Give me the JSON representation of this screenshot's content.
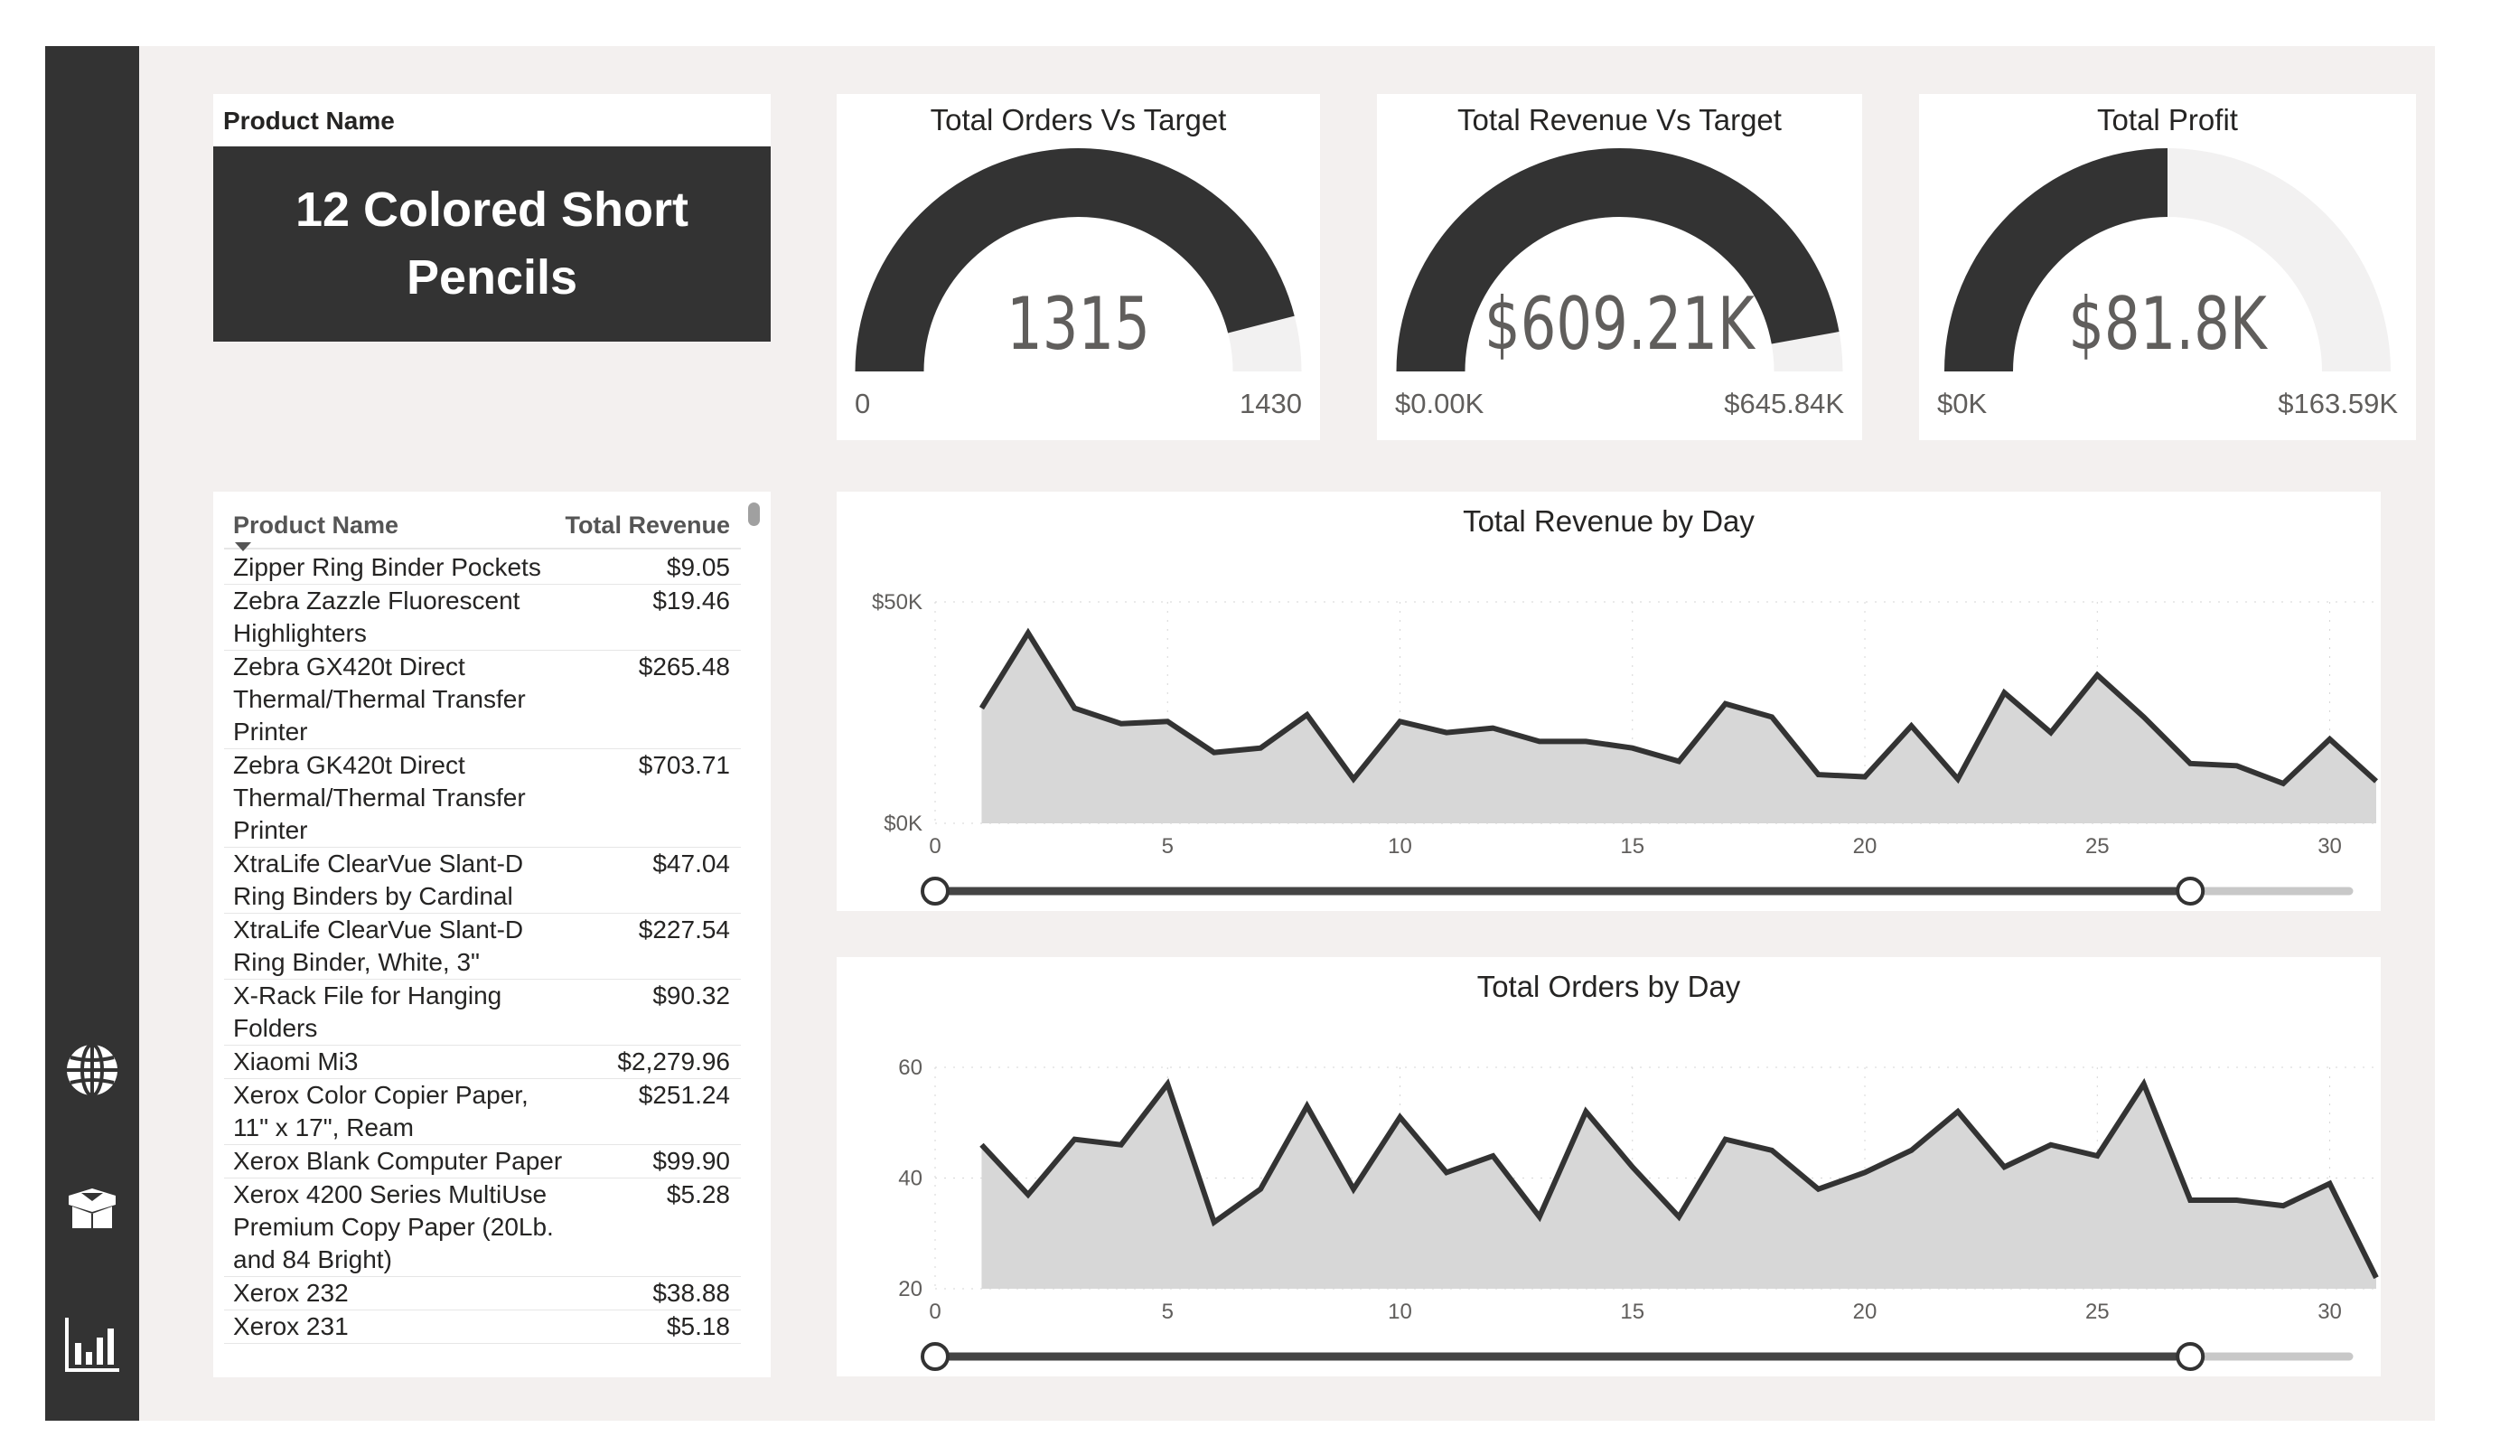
{
  "sidebar": {
    "icons": [
      "globe-icon",
      "box-icon",
      "bar-chart-icon"
    ]
  },
  "product_card": {
    "label": "Product Name",
    "value": "12 Colored Short Pencils"
  },
  "gauges": [
    {
      "title": "Total Orders Vs Target",
      "value": "1315",
      "min": "0",
      "max": "1430",
      "fill_fraction": 0.92
    },
    {
      "title": "Total Revenue Vs Target",
      "value": "$609.21K",
      "min": "$0.00K",
      "max": "$645.84K",
      "fill_fraction": 0.943
    },
    {
      "title": "Total Profit",
      "value": "$81.8K",
      "min": "$0K",
      "max": "$163.59K",
      "fill_fraction": 0.5
    }
  ],
  "table": {
    "headers": [
      "Product Name",
      "Total Revenue"
    ],
    "rows": [
      {
        "name": "Zipper Ring Binder Pockets",
        "revenue": "$9.05"
      },
      {
        "name": "Zebra Zazzle Fluorescent Highlighters",
        "revenue": "$19.46"
      },
      {
        "name": "Zebra GX420t Direct Thermal/Thermal Transfer Printer",
        "revenue": "$265.48"
      },
      {
        "name": "Zebra GK420t Direct Thermal/Thermal Transfer Printer",
        "revenue": "$703.71"
      },
      {
        "name": "XtraLife ClearVue Slant-D Ring Binders by Cardinal",
        "revenue": "$47.04"
      },
      {
        "name": "XtraLife ClearVue Slant-D Ring Binder, White, 3\"",
        "revenue": "$227.54"
      },
      {
        "name": "X-Rack File for Hanging Folders",
        "revenue": "$90.32"
      },
      {
        "name": "Xiaomi Mi3",
        "revenue": "$2,279.96"
      },
      {
        "name": "Xerox Color Copier Paper, 11\" x 17\", Ream",
        "revenue": "$251.24"
      },
      {
        "name": "Xerox Blank Computer Paper",
        "revenue": "$99.90"
      },
      {
        "name": "Xerox 4200 Series MultiUse Premium Copy Paper (20Lb. and 84 Bright)",
        "revenue": "$5.28"
      },
      {
        "name": "Xerox 232",
        "revenue": "$38.88"
      },
      {
        "name": "Xerox 231",
        "revenue": "$5.18"
      }
    ]
  },
  "chart_data": [
    {
      "type": "area",
      "title": "Total Revenue by Day",
      "xlabel": "",
      "ylabel": "",
      "x": [
        1,
        2,
        3,
        4,
        5,
        6,
        7,
        8,
        9,
        10,
        11,
        12,
        13,
        14,
        15,
        16,
        17,
        18,
        19,
        20,
        21,
        22,
        23,
        24,
        25,
        26,
        27,
        28,
        29,
        30,
        31
      ],
      "values": [
        26000,
        43000,
        26000,
        22500,
        23000,
        16000,
        17000,
        24500,
        10000,
        23000,
        20500,
        21500,
        18500,
        18500,
        17000,
        14000,
        27000,
        24000,
        11000,
        10500,
        22000,
        10000,
        29500,
        20500,
        33500,
        24000,
        13500,
        13000,
        9000,
        19000,
        9500
      ],
      "x_ticks": [
        "0",
        "5",
        "10",
        "15",
        "20",
        "25",
        "30"
      ],
      "x_tick_values": [
        0,
        5,
        10,
        15,
        20,
        25,
        30
      ],
      "y_ticks": [
        "$0K",
        "$50K"
      ],
      "y_tick_values": [
        0,
        50000
      ],
      "xlim": [
        0,
        31
      ],
      "ylim": [
        0,
        50000
      ],
      "slider": {
        "start": 0,
        "end": 27
      }
    },
    {
      "type": "area",
      "title": "Total Orders by Day",
      "xlabel": "",
      "ylabel": "",
      "x": [
        1,
        2,
        3,
        4,
        5,
        6,
        7,
        8,
        9,
        10,
        11,
        12,
        13,
        14,
        15,
        16,
        17,
        18,
        19,
        20,
        21,
        22,
        23,
        24,
        25,
        26,
        27,
        28,
        29,
        30,
        31
      ],
      "values": [
        46,
        37,
        47,
        46,
        57,
        32,
        38,
        53,
        38,
        51,
        41,
        44,
        33,
        52,
        42,
        33,
        47,
        45,
        38,
        41,
        45,
        52,
        42,
        46,
        44,
        57,
        36,
        36,
        35,
        39,
        22
      ],
      "x_ticks": [
        "0",
        "5",
        "10",
        "15",
        "20",
        "25",
        "30"
      ],
      "x_tick_values": [
        0,
        5,
        10,
        15,
        20,
        25,
        30
      ],
      "y_ticks": [
        "20",
        "40",
        "60"
      ],
      "y_tick_values": [
        20,
        40,
        60
      ],
      "xlim": [
        0,
        31
      ],
      "ylim": [
        20,
        60
      ],
      "slider": {
        "start": 0,
        "end": 27
      }
    }
  ]
}
